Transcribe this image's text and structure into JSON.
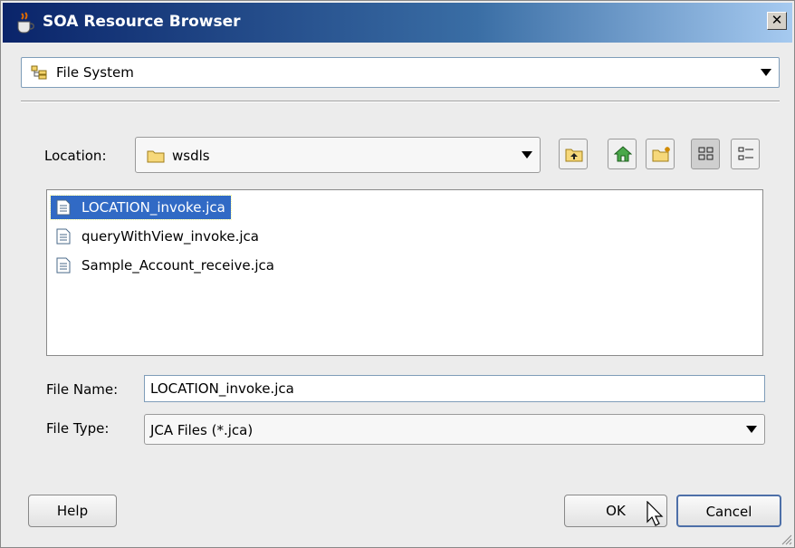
{
  "window": {
    "title": "SOA Resource Browser",
    "close_label": "✕"
  },
  "source_combo": {
    "value": "File System"
  },
  "location": {
    "label": "Location:",
    "value": "wsdls"
  },
  "files": [
    {
      "name": "LOCATION_invoke.jca",
      "selected": true
    },
    {
      "name": "queryWithView_invoke.jca",
      "selected": false
    },
    {
      "name": "Sample_Account_receive.jca",
      "selected": false
    }
  ],
  "file_name": {
    "label": "File Name:",
    "value": "LOCATION_invoke.jca"
  },
  "file_type": {
    "label": "File Type:",
    "value": "JCA Files (*.jca)"
  },
  "buttons": {
    "help": "Help",
    "ok": "OK",
    "cancel": "Cancel"
  }
}
